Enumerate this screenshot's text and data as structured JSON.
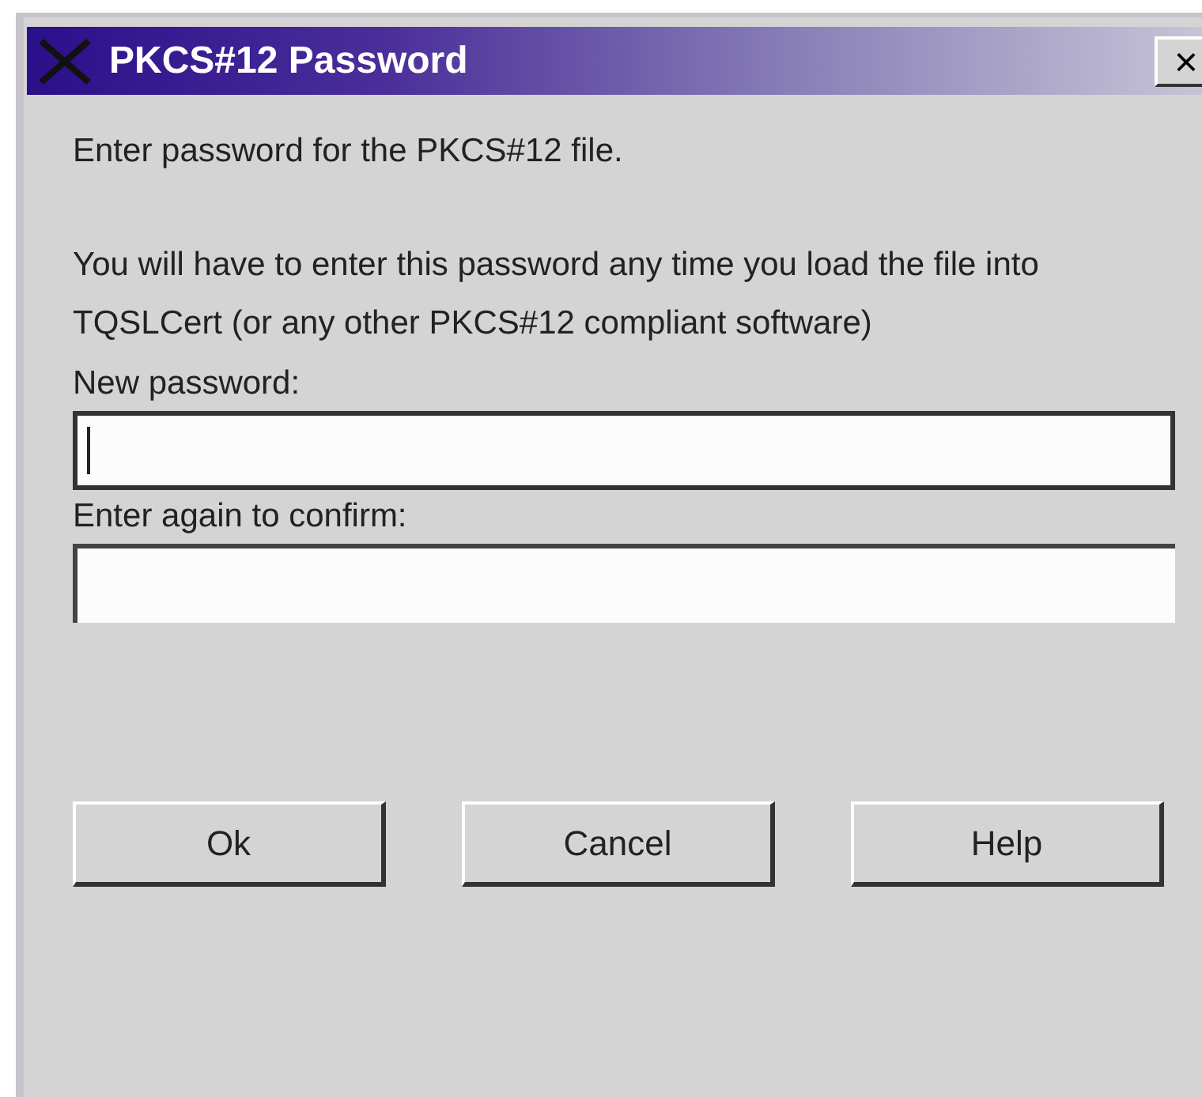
{
  "window": {
    "title": "PKCS#12 Password",
    "close_label": "×"
  },
  "intro": "Enter password for the PKCS#12 file.",
  "note": "You will have to enter this password any time you load the file into TQSLCert (or any other PKCS#12 compliant software)",
  "fields": [
    {
      "label": "New password:",
      "focused": true
    },
    {
      "label": "Enter again to confirm:",
      "focused": false
    }
  ],
  "buttons": [
    "Ok",
    "Cancel",
    "Help"
  ]
}
